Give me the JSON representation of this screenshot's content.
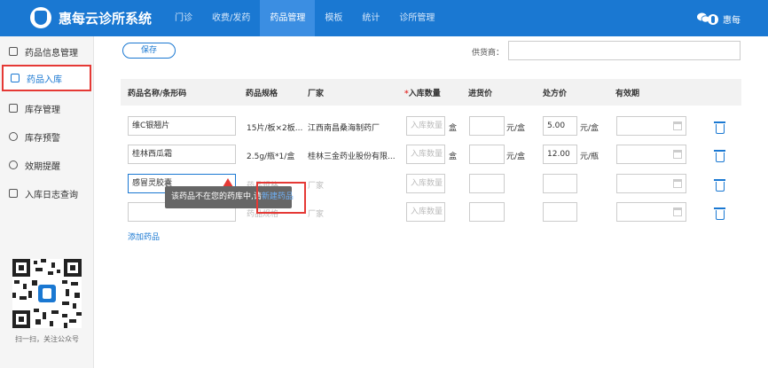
{
  "header": {
    "brand": "惠每云诊所系统",
    "nav": [
      "门诊",
      "收费/发药",
      "药品管理",
      "模板",
      "统计",
      "诊所管理"
    ],
    "active_nav": "药品管理",
    "user": "惠每"
  },
  "sidebar": {
    "items": [
      "药品信息管理",
      "药品入库",
      "库存管理",
      "库存预警",
      "效期提醒",
      "入库日志查询"
    ],
    "active": "药品入库",
    "qr_caption": "扫一扫，关注公众号"
  },
  "toolbar": {
    "save": "保存",
    "supplier_label": "供货商："
  },
  "table": {
    "headers": [
      "药品名称/条形码",
      "药品规格",
      "厂家",
      "入库数量",
      "进货价",
      "处方价",
      "有效期"
    ],
    "required_marker": "*",
    "rows": [
      {
        "name": "维C银翘片",
        "spec": "15片/板×2板...",
        "maker": "江西南昌桑海制药厂",
        "qty_ph": "入库数量",
        "unit": "盒",
        "buy_unit": "元/盒",
        "price": "5.00",
        "price_unit": "元/盒"
      },
      {
        "name": "桂林西瓜霜",
        "spec": "2.5g/瓶*1/盒",
        "maker": "桂林三金药业股份有限...",
        "qty_ph": "入库数量",
        "unit": "盒",
        "buy_unit": "元/盒",
        "price": "12.00",
        "price_unit": "元/瓶"
      },
      {
        "name": "感冒灵胶囊",
        "spec": "药品规格",
        "maker": "厂家",
        "qty_ph": "入库数量"
      },
      {
        "name": "",
        "spec": "药品规格",
        "maker": "厂家",
        "qty_ph": "入库数量"
      }
    ],
    "add": "添加药品"
  },
  "tooltip": {
    "text": "该药品不在您的药库中,请",
    "link": "新建药品"
  }
}
